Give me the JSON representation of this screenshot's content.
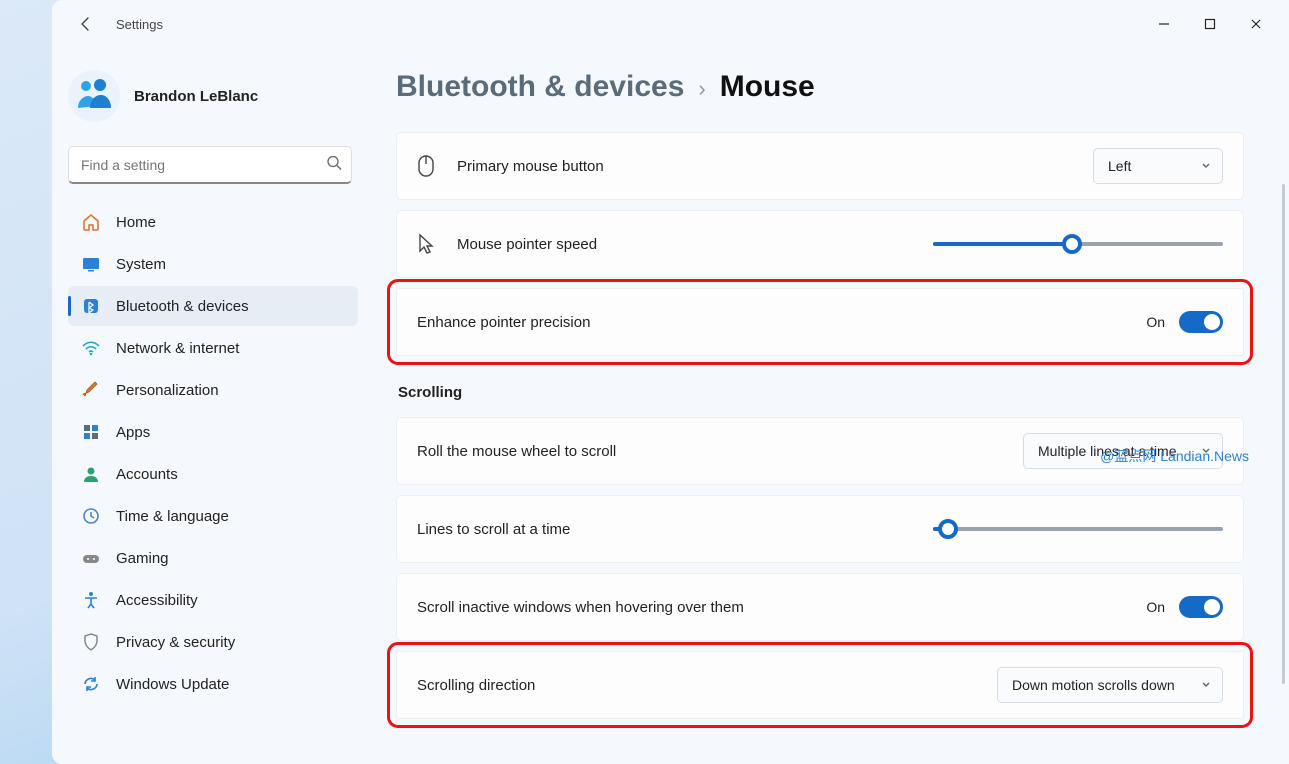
{
  "app": {
    "title": "Settings"
  },
  "user": {
    "name": "Brandon LeBlanc"
  },
  "search": {
    "placeholder": "Find a setting"
  },
  "sidebar": {
    "items": [
      {
        "id": "home",
        "label": "Home"
      },
      {
        "id": "system",
        "label": "System"
      },
      {
        "id": "bluetooth",
        "label": "Bluetooth & devices"
      },
      {
        "id": "network",
        "label": "Network & internet"
      },
      {
        "id": "personalization",
        "label": "Personalization"
      },
      {
        "id": "apps",
        "label": "Apps"
      },
      {
        "id": "accounts",
        "label": "Accounts"
      },
      {
        "id": "time",
        "label": "Time & language"
      },
      {
        "id": "gaming",
        "label": "Gaming"
      },
      {
        "id": "accessibility",
        "label": "Accessibility"
      },
      {
        "id": "privacy",
        "label": "Privacy & security"
      },
      {
        "id": "update",
        "label": "Windows Update"
      }
    ]
  },
  "breadcrumb": {
    "parent": "Bluetooth & devices",
    "sep": "›",
    "current": "Mouse"
  },
  "settings": {
    "primary_button": {
      "label": "Primary mouse button",
      "value": "Left"
    },
    "pointer_speed": {
      "label": "Mouse pointer speed",
      "percent": 48
    },
    "enhance_precision": {
      "label": "Enhance pointer precision",
      "state": "On"
    },
    "section_scrolling": "Scrolling",
    "roll_wheel": {
      "label": "Roll the mouse wheel to scroll",
      "value": "Multiple lines at a time"
    },
    "lines_scroll": {
      "label": "Lines to scroll at a time",
      "percent": 5
    },
    "scroll_inactive": {
      "label": "Scroll inactive windows when hovering over them",
      "state": "On"
    },
    "scroll_direction": {
      "label": "Scrolling direction",
      "value": "Down motion scrolls down"
    }
  },
  "watermark": "@蓝点网 Landian.News"
}
